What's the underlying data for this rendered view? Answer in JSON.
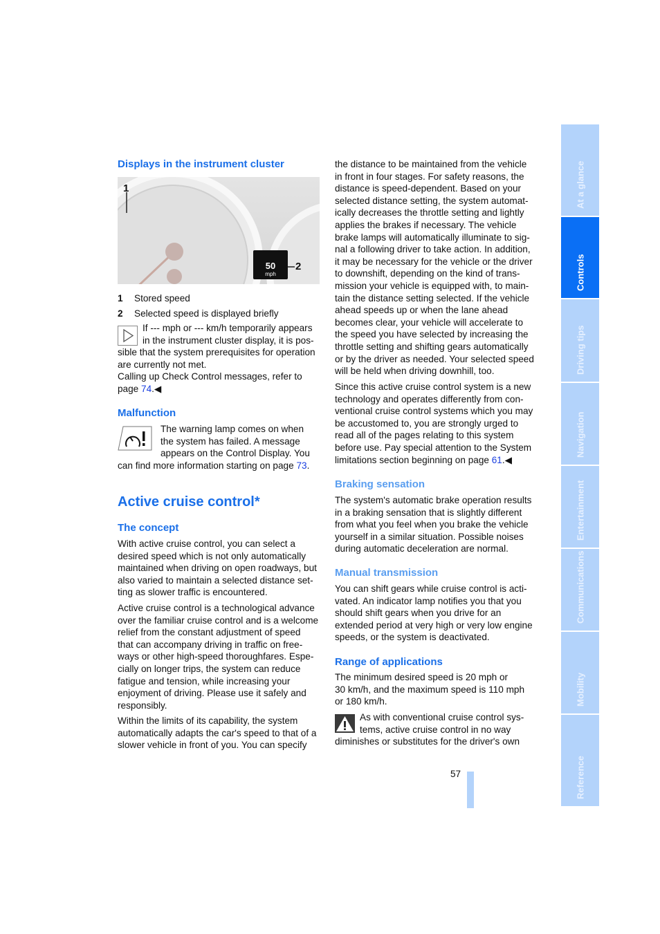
{
  "sidebar": {
    "tabs": [
      {
        "label": "At a glance",
        "active": false
      },
      {
        "label": "Controls",
        "active": true
      },
      {
        "label": "Driving tips",
        "active": false
      },
      {
        "label": "Navigation",
        "active": false
      },
      {
        "label": "Entertainment",
        "active": false
      },
      {
        "label": "Communications",
        "active": false
      },
      {
        "label": "Mobility",
        "active": false
      },
      {
        "label": "Reference",
        "active": false
      }
    ]
  },
  "col1": {
    "displays_heading": "Displays in the instrument cluster",
    "figure": {
      "callout1": "1",
      "callout2": "2",
      "display_speed": "50",
      "display_unit": "mph"
    },
    "legend": [
      {
        "num": "1",
        "text": "Stored speed"
      },
      {
        "num": "2",
        "text": "Selected speed is displayed briefly"
      }
    ],
    "note": {
      "icon": "triangle-play-icon",
      "lines": [
        "If --- mph or --- km/h temporarily appears",
        "in the instrument cluster display, it is pos-",
        "sible that the system prerequisites for operation",
        "are currently not met.",
        "Calling up Check Control messages, refer to"
      ],
      "last_prefix": "page ",
      "link": "74",
      "end": ".◀"
    },
    "malfunction_heading": "Malfunction",
    "malfunction": {
      "icon": "cruise-warning-lamp-icon",
      "lines": [
        "The warning lamp comes on when",
        "the system has failed. A message",
        "appears on the Control Display. You"
      ],
      "last_prefix": "can find more information starting on page ",
      "link": "73",
      "end": "."
    },
    "title": "Active cruise control*",
    "concept_heading": "The concept",
    "p1": [
      "With active cruise control, you can select a",
      "desired speed which is not only automatically",
      "maintained when driving on open roadways, but",
      "also varied to maintain a selected distance set-",
      "ting as slower traffic is encountered."
    ],
    "p2": [
      "Active cruise control is a technological advance",
      "over the familiar cruise control and is a welcome",
      "relief from the constant adjustment of speed",
      "that can accompany driving in traffic on free-",
      "ways or other high-speed thoroughfares. Espe-",
      "cially on longer trips, the system can reduce",
      "fatigue and tension, while increasing your",
      "enjoyment of driving. Please use it safely and",
      "responsibly."
    ],
    "p3": [
      "Within the limits of its capability, the system",
      "automatically adapts the car's speed to that of a",
      "slower vehicle in front of you. You can specify"
    ]
  },
  "col2": {
    "p1": [
      "the distance to be maintained from the vehicle",
      "in front in four stages. For safety reasons, the",
      "distance is speed-dependent. Based on your",
      "selected distance setting, the system automat-",
      "ically decreases the throttle setting and lightly",
      "applies the brakes if necessary. The vehicle",
      "brake lamps will automatically illuminate to sig-",
      "nal a following driver to take action. In addition,",
      "it may be necessary for the vehicle or the driver",
      "to downshift, depending on the kind of trans-",
      "mission your vehicle is equipped with, to main-",
      "tain the distance setting selected. If the vehicle",
      "ahead speeds up or when the lane ahead",
      "becomes clear, your vehicle will accelerate to",
      "the speed you have selected by increasing the",
      "throttle setting and shifting gears automatically",
      "or by the driver as needed. Your selected speed",
      "will be held when driving downhill, too."
    ],
    "p2": {
      "lines": [
        "Since this active cruise control system is a new",
        "technology and operates differently from con-",
        "ventional cruise control systems which you may",
        "be accustomed to, you are strongly urged to",
        "read all of the pages relating to this system",
        "before use. Pay special attention to the System"
      ],
      "last_prefix": "limitations section beginning on page ",
      "link": "61",
      "end": ".◀"
    },
    "braking_heading": "Braking sensation",
    "braking": [
      "The system's automatic brake operation results",
      "in a braking sensation that is slightly different",
      "from what you feel when you brake the vehicle",
      "yourself in a similar situation. Possible noises",
      "during automatic deceleration are normal."
    ],
    "manual_heading": "Manual transmission",
    "manual": [
      "You can shift gears while cruise control is acti-",
      "vated. An indicator lamp notifies you that you",
      "should shift gears when you drive for an",
      "extended period at very high or very low engine",
      "speeds, or the system is deactivated."
    ],
    "range_heading": "Range of applications",
    "range": [
      "The minimum desired speed is 20 mph or",
      "30 km/h, and the maximum speed is 110 mph",
      "or 180 km/h."
    ],
    "warning": {
      "icon": "warning-triangle-icon",
      "lines": [
        "As with conventional cruise control sys-",
        "tems, active cruise control in no way",
        "diminishes or substitutes for the driver's own"
      ]
    }
  },
  "footer": {
    "page_number": "57"
  },
  "colors": {
    "heading": "#1a6fe8",
    "heading_light": "#5a9ef0",
    "tab": "#b3d3fb",
    "tab_active": "#0a6ff5",
    "link": "#1a3fe0"
  }
}
